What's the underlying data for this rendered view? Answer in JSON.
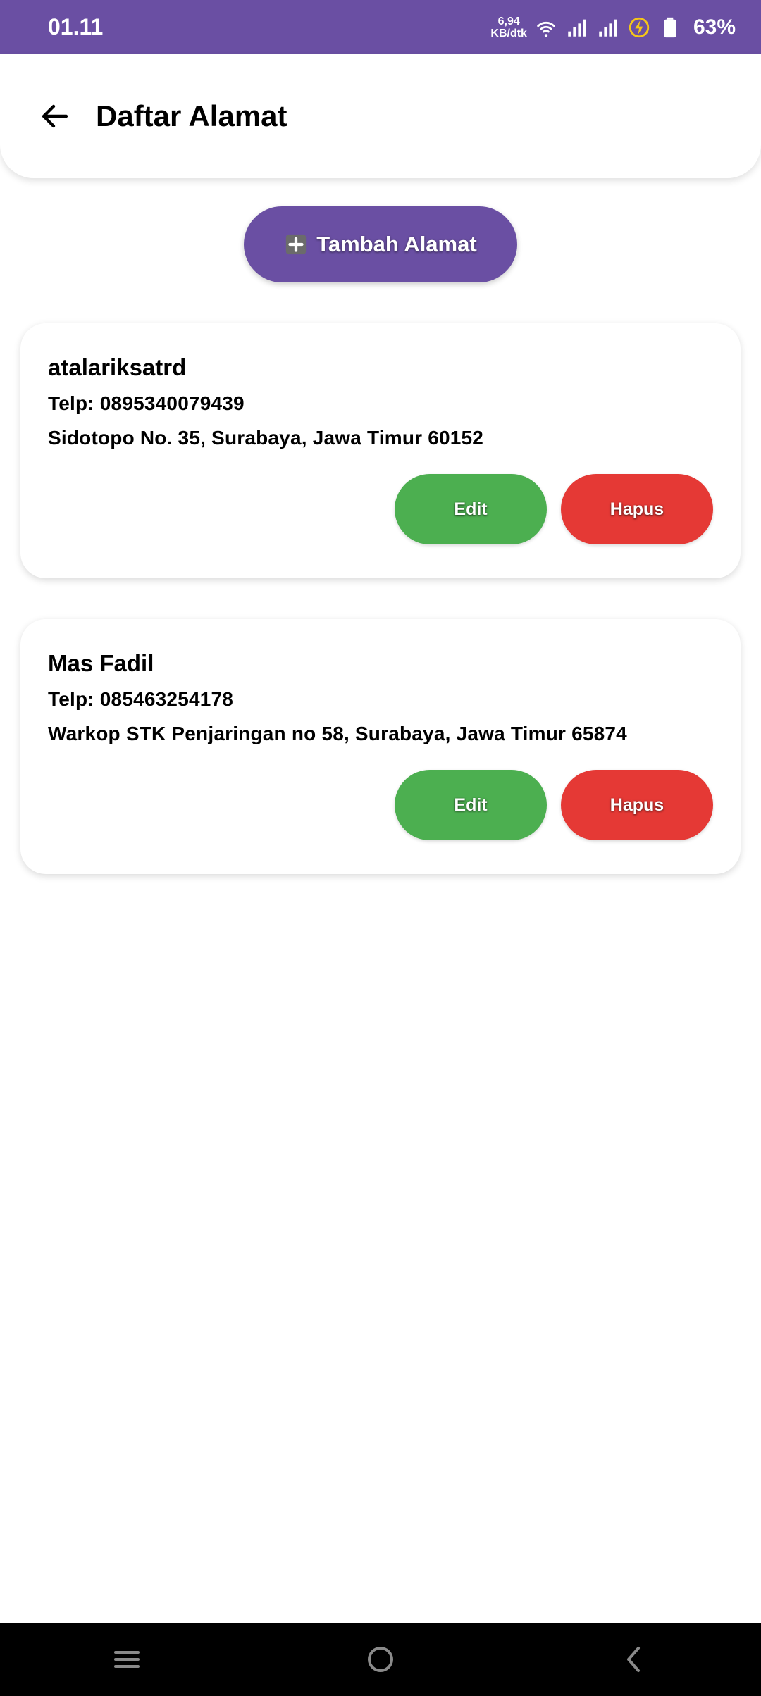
{
  "status_bar": {
    "time": "01.11",
    "net_speed_value": "6,94",
    "net_speed_unit": "KB/dtk",
    "battery": "63%"
  },
  "header": {
    "title": "Daftar Alamat"
  },
  "add_button": {
    "label": "Tambah Alamat"
  },
  "addresses": [
    {
      "name": "atalariksatrd",
      "phone": "Telp: 0895340079439",
      "address": "Sidotopo No. 35, Surabaya, Jawa Timur 60152",
      "edit_label": "Edit",
      "delete_label": "Hapus"
    },
    {
      "name": "Mas Fadil",
      "phone": "Telp: 085463254178",
      "address": "Warkop STK Penjaringan no 58, Surabaya, Jawa Timur 65874",
      "edit_label": "Edit",
      "delete_label": "Hapus"
    }
  ],
  "colors": {
    "primary": "#6a4fa3",
    "edit": "#4caf50",
    "delete": "#e53935"
  }
}
